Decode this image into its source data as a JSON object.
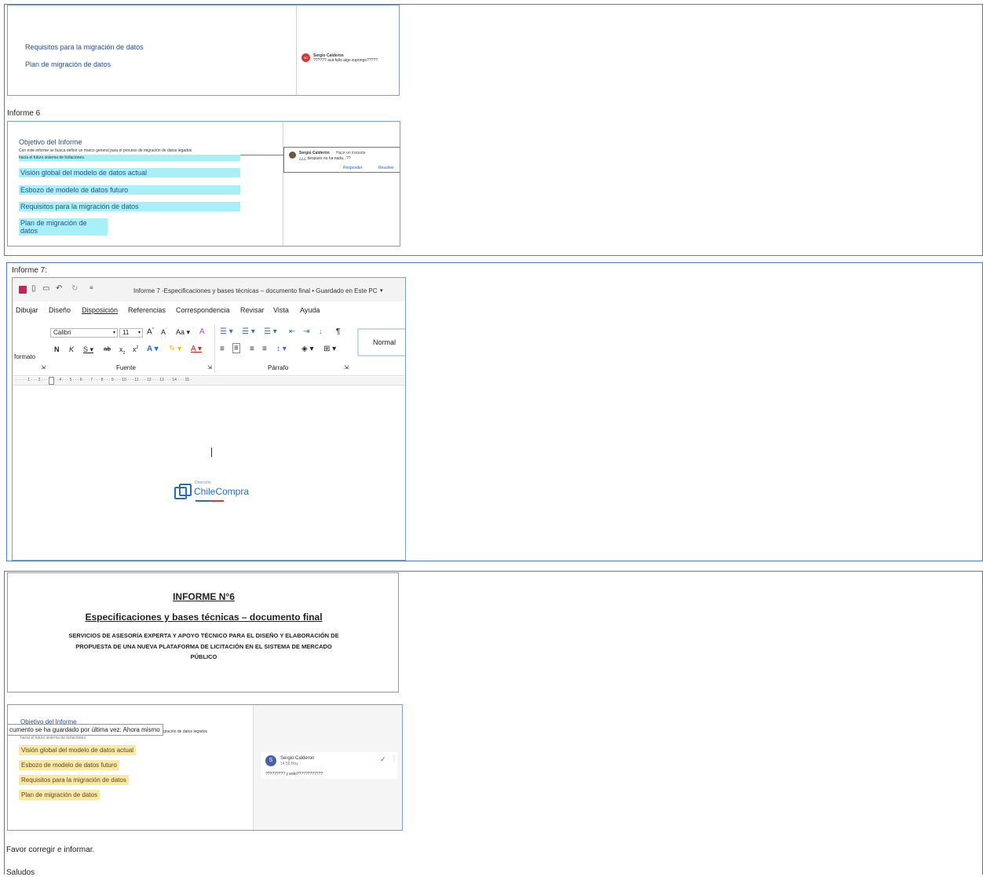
{
  "shot1": {
    "items": [
      "Requisitos para la migración de datos",
      "Plan de migración de datos"
    ],
    "comment": {
      "avatar": "SC",
      "name": "Sergio Calderon",
      "text": "?????? acá fallo algo supongo?????"
    }
  },
  "label6": "Informe 6",
  "shot2": {
    "heading": "Objetivo del Informe",
    "para1": "Con este informe se busca definir un marco general para el proceso de migración de datos legados",
    "para2": "hacia el futuro sistema de licitaciones.",
    "items": [
      "Visión global del modelo de datos actual",
      "Esbozo de modelo de datos futuro",
      "Requisitos para la migración de datos",
      "Plan de migración de datos"
    ],
    "comment": {
      "name": "Sergio Calderón",
      "meta": "Hace un instante",
      "text": "¿¿¿ después no ha nada...??",
      "reply": "Responder",
      "resolve": "Resolver"
    }
  },
  "label7": "Informe 7:",
  "word": {
    "doc_title": "Informe 7 -Especificaciones y bases técnicas – documento final • Guardado en Este PC",
    "menu": [
      "Dibujar",
      "Diseño",
      "Disposición",
      "Referencias",
      "Correspondencia",
      "Revisar",
      "Vista",
      "Ayuda"
    ],
    "font_name": "Calibri",
    "font_size": "11",
    "formato": "formato",
    "group_fuente": "Fuente",
    "group_parrafo": "Párrafo",
    "style_normal": "Normal",
    "ruler": "· · · ·   · 1 · · · 2 · · · 3 · · · 4 · · · 5 · · · 6 · · · 7 · · · 8 · · · 9 · · · 10 · · · 11 · · · 12 · · · 13 · · · 14 · · · 15 ·",
    "logo_small": "Dirección",
    "logo_main": "ChileCompra"
  },
  "shot3": {
    "title": "INFORME N°6",
    "subtitle": "Especificaciones y bases técnicas – documento final",
    "line1": "SERVICIOS DE ASESORÍA EXPERTA Y APOYO TÉCNICO PARA EL DISEÑO Y ELABORACIÓN DE",
    "line2": "PROPUESTA DE UNA NUEVA PLATAFORMA DE LICITACIÓN EN EL SISTEMA DE MERCADO",
    "line3": "PÚBLICO"
  },
  "shot4": {
    "heading": "Objetivo del Informe",
    "tooltip": "cumento se ha guardado por última vez: Ahora mismo",
    "para_right": "igración de datos legados",
    "para2": "hacia el futuro sistema de licitaciones.",
    "items": [
      "Visión global del modelo de datos actual",
      "Esbozo de modelo de datos futuro",
      "Requisitos para la migración de datos",
      "Plan de migración de datos"
    ],
    "comment": {
      "avatar": "S",
      "name": "Sergio Calderon",
      "time": "14:56 Hoy",
      "text": "????????? y esto????????????"
    }
  },
  "footer1": "Favor corregir e informar.",
  "footer2": "Saludos"
}
